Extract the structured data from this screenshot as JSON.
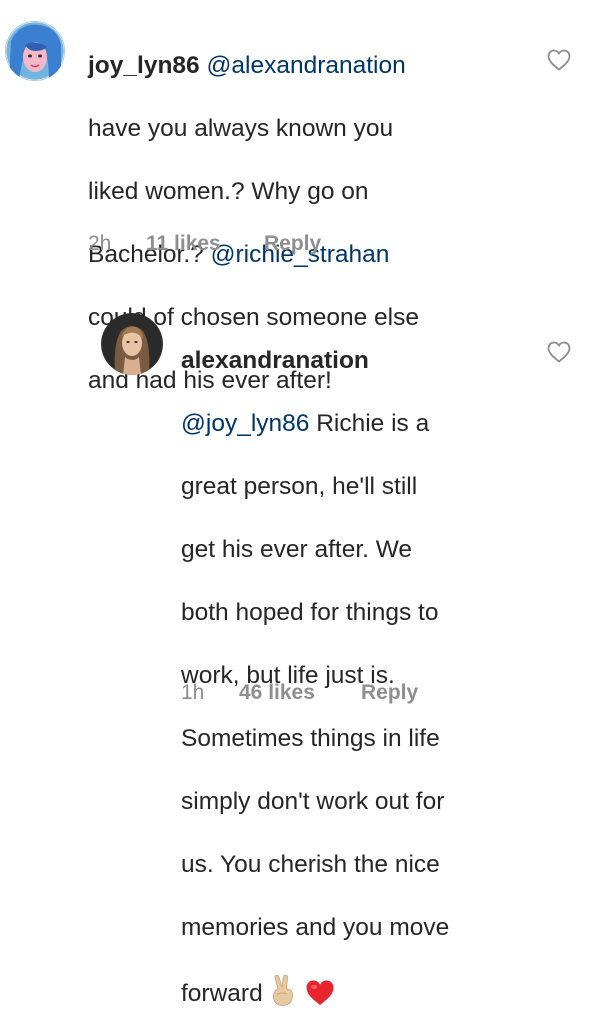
{
  "comments": [
    {
      "username": "joy_lyn86",
      "mention": "@alexandranation",
      "text_line1_rest": "",
      "lines": [
        "have you always known you",
        "liked women.? Why go on",
        "Bachelor.? "
      ],
      "mention2": "@richie_strahan",
      "lines_after": [
        "could of chosen someone else",
        "and had his ever after!"
      ],
      "time": "2h",
      "likes": "11 likes",
      "reply": "Reply",
      "like_icon": "heart-outline-icon"
    },
    {
      "username": "alexandranation",
      "mention": "@joy_lyn86",
      "first_line_rest": " Richie is a",
      "lines": [
        "great person, he'll still",
        "get his ever after. We",
        "both hoped for things to",
        "work, but life just is.",
        "Sometimes things in life",
        "simply don't work out for",
        "us. You cherish the nice",
        "memories and you move",
        "forward"
      ],
      "emojis": [
        "victory-hand-emoji",
        "red-heart-emoji"
      ],
      "time": "1h",
      "likes": "46 likes",
      "reply": "Reply",
      "like_icon": "heart-outline-icon"
    }
  ],
  "colors": {
    "text": "#262626",
    "mention": "#003569",
    "meta": "#8e8e8e",
    "heart_outline": "#8e8e8e",
    "red_heart": "#e8252f"
  }
}
